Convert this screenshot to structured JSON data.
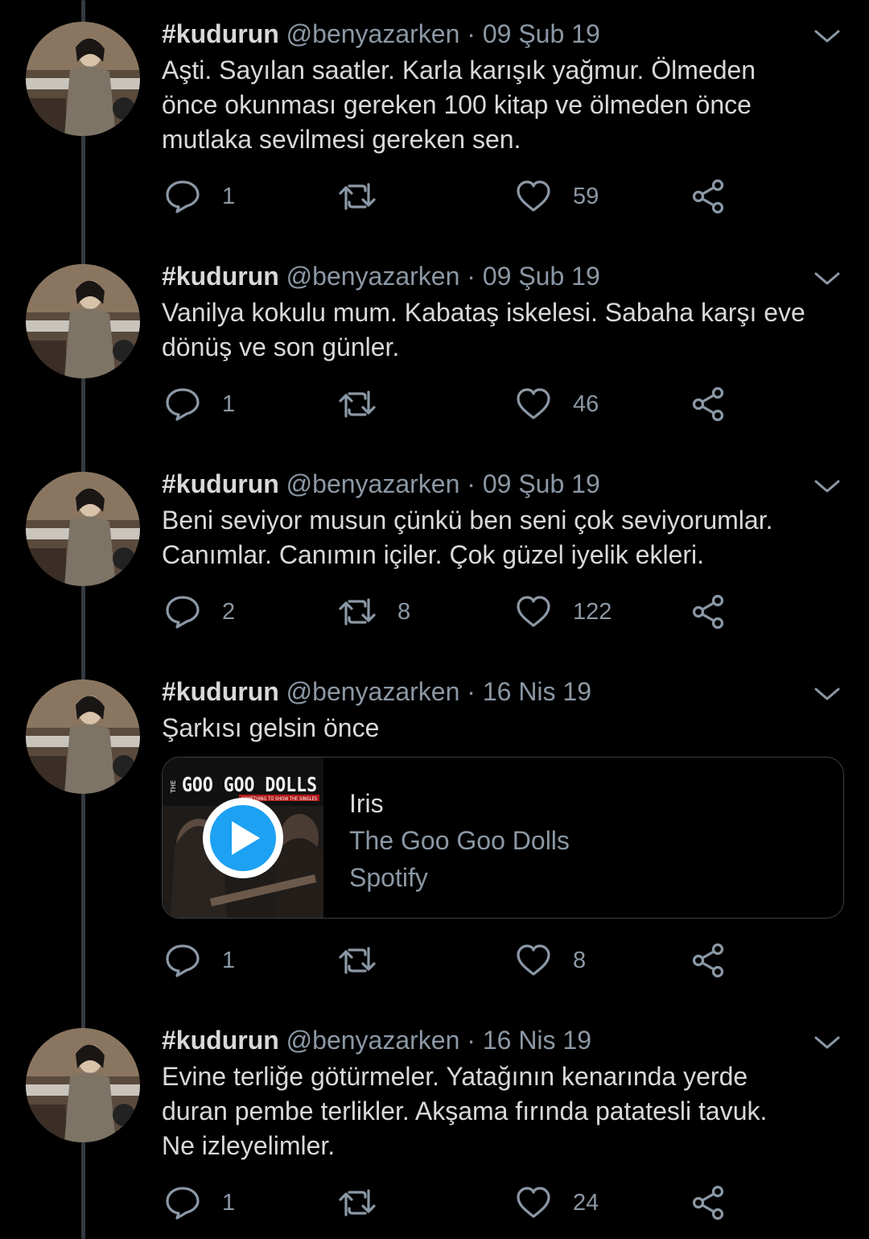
{
  "tweets": [
    {
      "name": "#kudurun",
      "handle": "@benyazarken",
      "separator": "·",
      "date": "09 Şub 19",
      "text_lines": [
        "Aşti. Sayılan saatler. Karla karışık yağmur. Ölmeden",
        "önce okunması gereken 100 kitap ve ölmeden önce",
        "mutlaka sevilmesi gereken sen."
      ],
      "replies": "1",
      "retweets": "",
      "likes": "59"
    },
    {
      "name": "#kudurun",
      "handle": "@benyazarken",
      "separator": "·",
      "date": "09 Şub 19",
      "text_lines": [
        "Vanilya kokulu mum. Kabataş iskelesi. Sabaha karşı eve",
        "dönüş ve son günler."
      ],
      "replies": "1",
      "retweets": "",
      "likes": "46"
    },
    {
      "name": "#kudurun",
      "handle": "@benyazarken",
      "separator": "·",
      "date": "09 Şub 19",
      "text_lines": [
        "Beni seviyor musun çünkü ben seni çok seviyorumlar.",
        "Canımlar. Canımın içiler. Çok güzel iyelik ekleri."
      ],
      "replies": "2",
      "retweets": "8",
      "likes": "122"
    },
    {
      "name": "#kudurun",
      "handle": "@benyazarken",
      "separator": "·",
      "date": "16 Nis 19",
      "text_lines": [
        "Şarkısı gelsin önce"
      ],
      "card": {
        "title": "Iris",
        "artist": "The Goo Goo Dolls",
        "source": "Spotify",
        "album_art_text": "GOO GOO DOLLS",
        "album_art_small": "THE",
        "album_art_sub": "SOMETHING TO SHOW THE SINGLES"
      },
      "replies": "1",
      "retweets": "",
      "likes": "8"
    },
    {
      "name": "#kudurun",
      "handle": "@benyazarken",
      "separator": "·",
      "date": "16 Nis 19",
      "text_lines": [
        "Evine terliğe götürmeler. Yatağının kenarında yerde",
        "duran pembe terlikler. Akşama fırında patatesli tavuk.",
        "Ne izleyelimler."
      ],
      "replies": "1",
      "retweets": "",
      "likes": "24"
    }
  ],
  "icons": {
    "reply": "reply-icon",
    "retweet": "retweet-icon",
    "like": "heart-icon",
    "share": "share-icon",
    "menu": "chevron-down-icon",
    "play": "play-icon"
  },
  "colors": {
    "background": "#000000",
    "text": "#d9d9d9",
    "secondary": "#8b98a5",
    "accent": "#1da1f2"
  }
}
